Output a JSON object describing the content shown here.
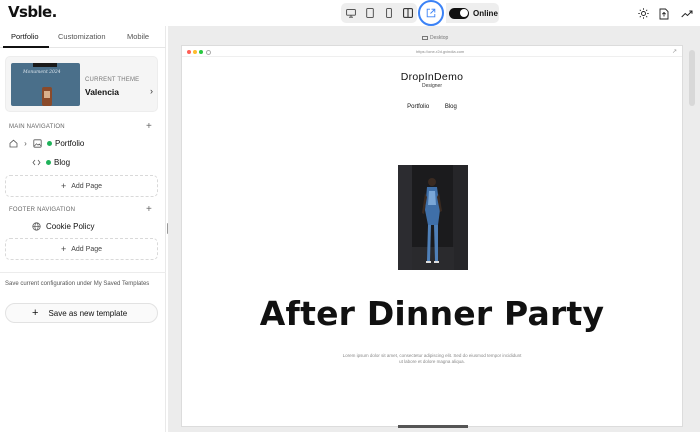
{
  "app": {
    "logo": "Vsble."
  },
  "topbar": {
    "online_label": "Online",
    "icons": [
      "desktop-icon",
      "tablet-icon",
      "mobile-icon",
      "split-view-icon",
      "external-preview-icon",
      "sun-icon",
      "publish-icon",
      "analytics-icon"
    ],
    "accent": "#3b82f6"
  },
  "sidebar": {
    "tabs": [
      {
        "label": "Portfolio"
      },
      {
        "label": "Customization"
      },
      {
        "label": "Mobile"
      }
    ],
    "theme": {
      "caption": "CURRENT THEME",
      "name": "Valencia",
      "thumb_text": "Monument 2024"
    },
    "main_nav": {
      "heading": "MAIN NAVIGATION",
      "items": [
        {
          "label": "Portfolio",
          "status_color": "#1fb25a"
        },
        {
          "label": "Blog",
          "status_color": "#1fb25a"
        }
      ],
      "add_label": "Add Page"
    },
    "footer_nav": {
      "heading": "FOOTER NAVIGATION",
      "items": [
        {
          "label": "Cookie Policy"
        }
      ],
      "add_label": "Add Page"
    },
    "save_note": "Save current configuration under My Saved Templates",
    "save_button": "Save as new template"
  },
  "preview": {
    "device_label": "Desktop",
    "url": "https://one-r2d.gvindia.com",
    "site_title": "DropInDemo",
    "site_subtitle": "Designer",
    "nav": [
      "Portfolio",
      "Blog"
    ],
    "hero": "After Dinner Party",
    "lorem": "Lorem ipsum dolor sit amet, consectetur adipiscing elit. Sed do eiusmod tempor incididunt ut labore et dolore magna aliqua."
  }
}
